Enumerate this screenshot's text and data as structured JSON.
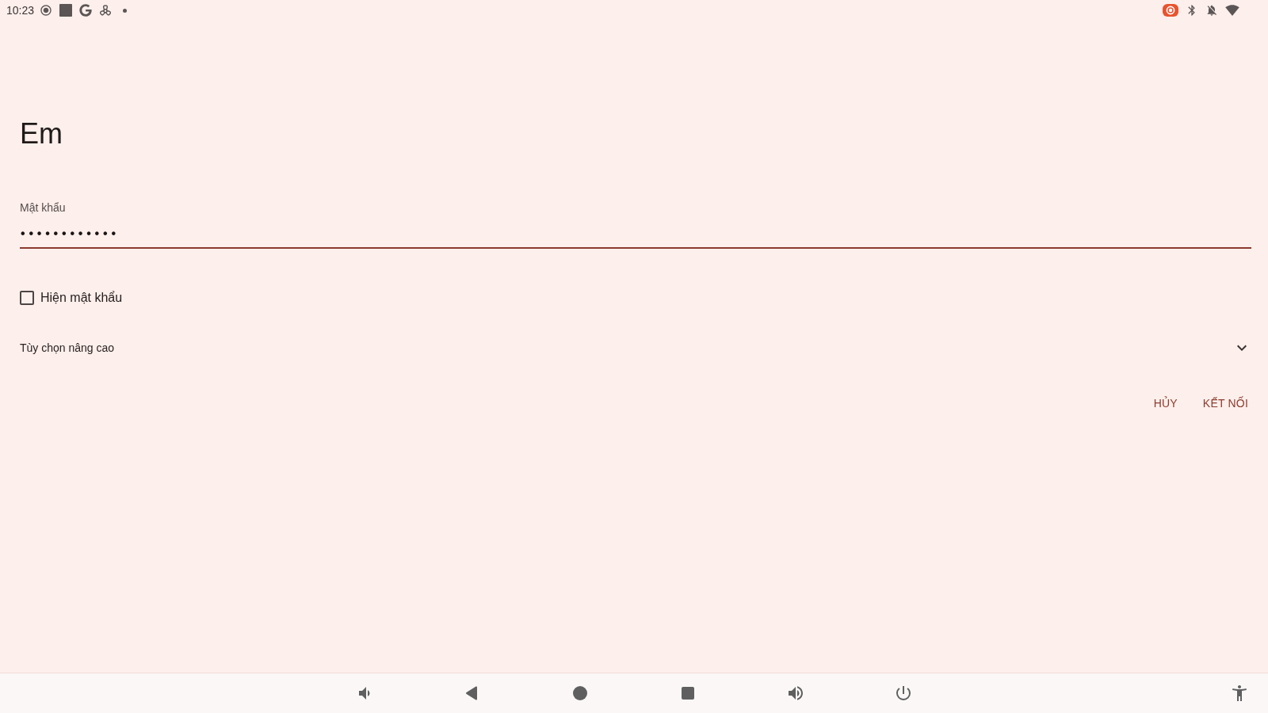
{
  "status_bar": {
    "time": "10:23"
  },
  "dialog": {
    "title": "Em",
    "password": {
      "label": "Mật khẩu",
      "value": "••••••••••••"
    },
    "show_password": {
      "label": "Hiện mật khẩu",
      "checked": false
    },
    "advanced_options": {
      "label": "Tùy chọn nâng cao",
      "expanded": false
    },
    "buttons": [
      {
        "label": "HỦY"
      },
      {
        "label": "KẾT NỐI"
      }
    ]
  }
}
